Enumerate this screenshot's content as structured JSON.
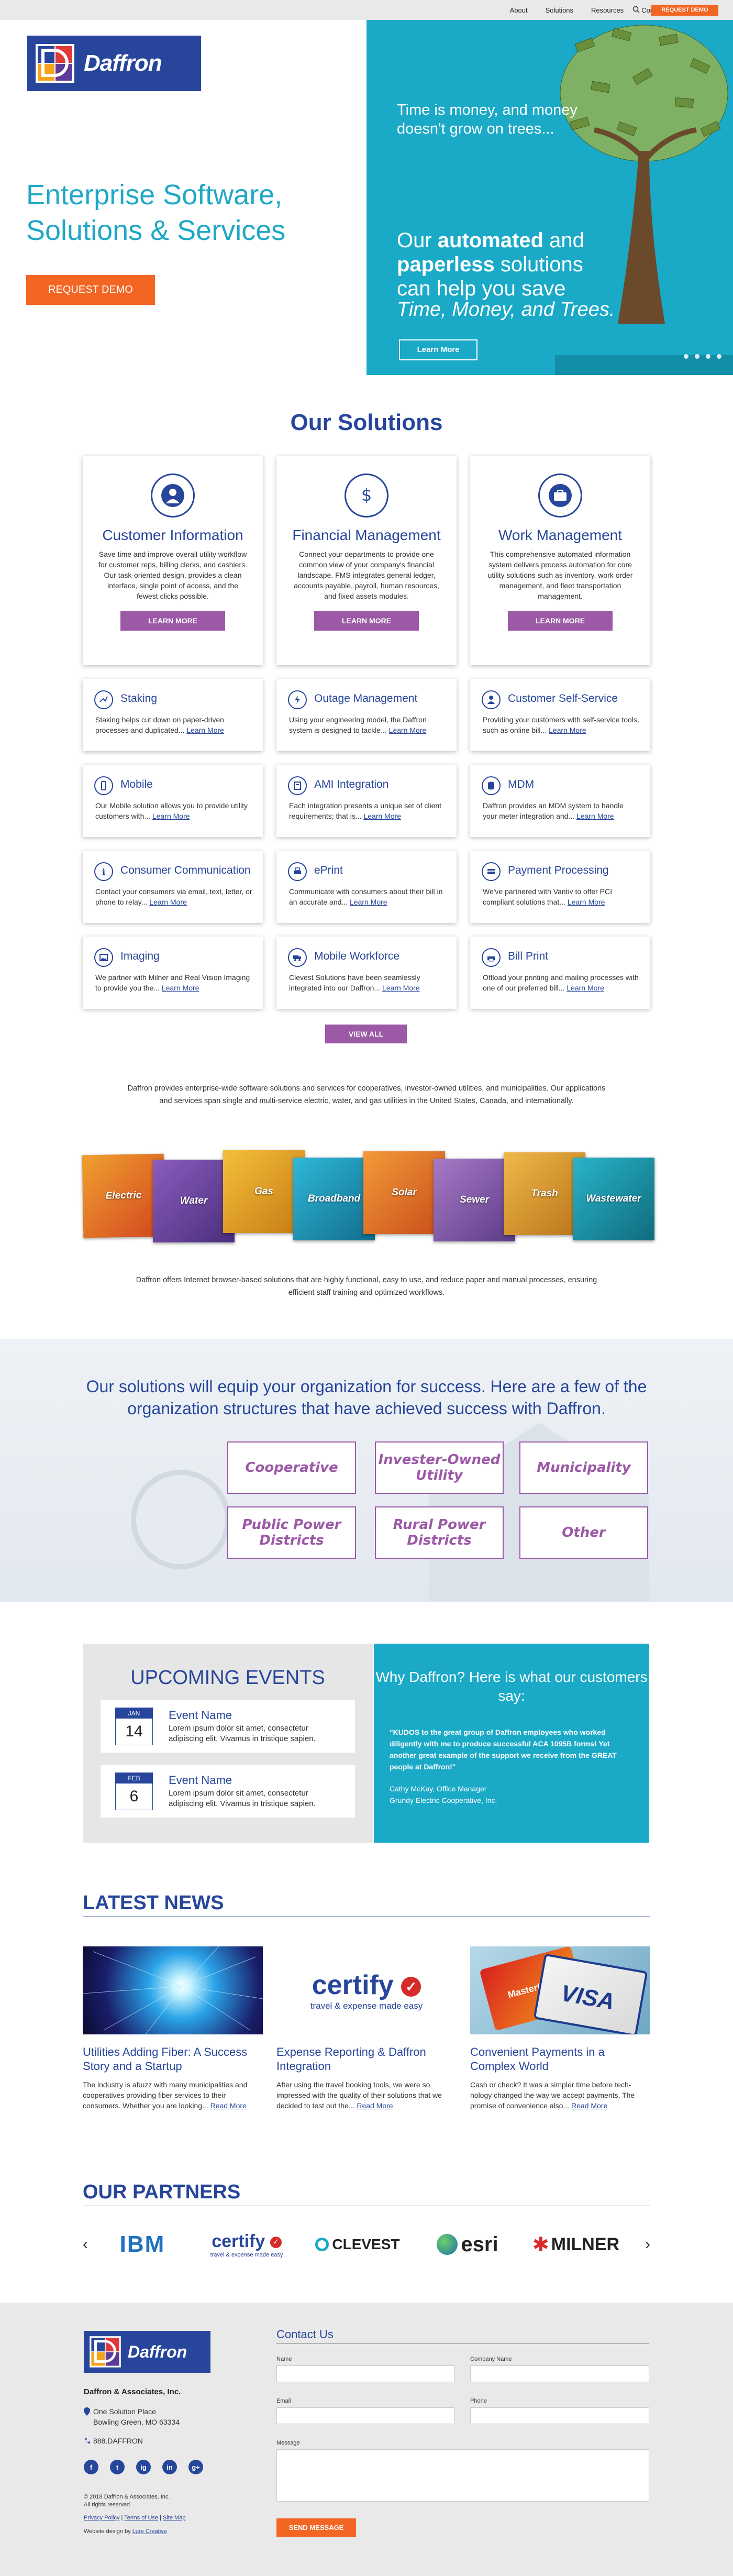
{
  "topnav": {
    "links": [
      "About",
      "Solutions",
      "Resources",
      "Contact"
    ],
    "demo": "REQUEST DEMO"
  },
  "hero": {
    "logo_text": "Daffron",
    "headline": "Enterprise Software, Solutions & Services",
    "cta": "REQUEST DEMO",
    "tagline1": "Time is money, and money doesn't grow on trees...",
    "tagline2_pre": "Our ",
    "tagline2_b1": "automated",
    "tagline2_mid": " and ",
    "tagline2_b2": "paperless",
    "tagline2_post": " solutions can help you save",
    "tagline3": "Time, Money, and Trees.",
    "more": "Learn More"
  },
  "solutions": {
    "title": "Our Solutions",
    "big": [
      {
        "title": "Customer Information",
        "icon": "user-icon",
        "text": "Save time and improve overall utility workflow for customer reps, billing clerks, and cashiers. Our task-oriented design, provides a clean interface, single point of access, and the fewest clicks possible.",
        "button": "LEARN MORE"
      },
      {
        "title": "Financial Management",
        "icon": "dollar-icon",
        "text": "Connect your departments to provide one common view of your company's financial landscape. FMS integrates general ledger, accounts payable, payroll, human resources, and fixed assets modules.",
        "button": "LEARN MORE"
      },
      {
        "title": "Work Management",
        "icon": "briefcase-icon",
        "text": "This comprehensive automated information system delivers process automation for core utility solutions such as inventory, work order management, and fleet transportation management.",
        "button": "LEARN MORE"
      }
    ],
    "small": [
      {
        "title": "Staking",
        "icon": "staking-icon",
        "text": "Staking helps cut down on paper-driven processes and duplicated...",
        "more": "Learn More"
      },
      {
        "title": "Outage Management",
        "icon": "lightning-icon",
        "text": "Using your engineering model, the Daffron system is designed to tackle...",
        "more": "Learn More"
      },
      {
        "title": "Customer Self-Service",
        "icon": "person-icon",
        "text": "Providing your customers with self-service tools, such as online bill...",
        "more": "Learn More"
      },
      {
        "title": "Mobile",
        "icon": "mobile-icon",
        "text": "Our Mobile solution allows you to provide utility customers with...",
        "more": "Learn More"
      },
      {
        "title": "AMI Integration",
        "icon": "meter-icon",
        "text": "Each integration presents a unique set of client requirements; that is...",
        "more": "Learn More"
      },
      {
        "title": "MDM",
        "icon": "database-icon",
        "text": "Daffron provides an MDM system to handle your meter integration and...",
        "more": "Learn More"
      },
      {
        "title": "Consumer Communication",
        "icon": "info-icon",
        "text": "Contact your consumers via email, text, letter, or phone to relay...",
        "more": "Learn More"
      },
      {
        "title": "ePrint",
        "icon": "print-icon",
        "text": "Communicate with consumers about their bill in an accurate and...",
        "more": "Learn More"
      },
      {
        "title": "Payment Processing",
        "icon": "payment-icon",
        "text": "We've partnered with Vantiv to offer PCI compliant solutions that...",
        "more": "Learn More"
      },
      {
        "title": "Imaging",
        "icon": "image-icon",
        "text": "We partner with Milner and Real Vision Imaging to provide you the...",
        "more": "Learn More"
      },
      {
        "title": "Mobile Workforce",
        "icon": "truck-icon",
        "text": "Clevest Solutions have been seamlessly integrated into our Daffron...",
        "more": "Learn More"
      },
      {
        "title": "Bill Print",
        "icon": "printer-icon",
        "text": "Offload your printing and mailing processes with one of our preferred bill...",
        "more": "Learn More"
      }
    ],
    "view_all": "VIEW ALL",
    "para1": "Daffron provides enterprise-wide software solutions and services for cooperatives, investor-owned utilities, and municipalities. Our applications and services span single and multi-service electric, water, and gas utilities in the United States, Canada, and internationally.",
    "para2": "Daffron offers Internet browser-based solutions that are highly functional, easy to use, and reduce paper and manual processes, ensuring efficient staff training and optimized workflows."
  },
  "industries": [
    "Electric",
    "Water",
    "Gas",
    "Broadband",
    "Solar",
    "Sewer",
    "Trash",
    "Wastewater"
  ],
  "orgs": {
    "title": "Our solutions will equip your organization for success. Here are a few of the organization structures that have achieved success with Daffron.",
    "items": [
      "Cooperative",
      "Invester-Owned Utility",
      "Municipality",
      "Public Power Districts",
      "Rural Power Districts",
      "Other"
    ]
  },
  "events": {
    "title": "UPCOMING EVENTS",
    "items": [
      {
        "month": "JAN",
        "day": "14",
        "title": "Event Name",
        "text": "Lorem ipsum dolor sit amet, consectetur adipiscing elit. Vivamus in tristique sapien."
      },
      {
        "month": "FEB",
        "day": "6",
        "title": "Event Name",
        "text": "Lorem ipsum dolor sit amet, consectetur adipiscing elit. Vivamus in tristique sapien."
      }
    ]
  },
  "quote": {
    "title": "Why Daffron? Here is what our customers say:",
    "text": "\"KUDOS to the great group of Daffron employees who worked diligently with me to produce successful ACA 1095B forms! Yet another great example of the support we receive from the GREAT people at Daffron!\"",
    "name": "Cathy McKay, Office Manager",
    "org": "Grundy Electric Cooperative, Inc."
  },
  "news": {
    "title": "LATEST NEWS",
    "items": [
      {
        "title": "Utilities Adding Fiber: A Success Story and a Startup",
        "text": "The industry is abuzz with many municipalities and cooperatives providing fiber services to their consumers. Whether you are looking...",
        "more": "Read More"
      },
      {
        "title": "Expense Reporting & Daffron Integration",
        "text": "After using the travel booking tools, we were so impressed with the quality of their solutions that we decided to test out the...",
        "more": "Read More"
      },
      {
        "title": "Convenient Payments in a Complex World",
        "text": "Cash or check? It was a simpler time before tech-nology changed the way we accept payments. The promise of convenience also...",
        "more": "Read More"
      }
    ],
    "certify_word": "certify",
    "certify_tag": "travel & expense made easy",
    "card_visa": "VISA",
    "card_mc": "MasterCard"
  },
  "partners": {
    "title": "OUR PARTNERS",
    "logos": [
      "IBM",
      "certify",
      "CLEVEST",
      "esri",
      "MILNER"
    ],
    "certify_tag": "travel & expense made easy"
  },
  "footer": {
    "logo_text": "Daffron",
    "company": "Daffron & Associates, Inc.",
    "addr1": "One Solution Place",
    "addr2": "Bowling Green, MO 63334",
    "phone": "888.DAFFRON",
    "social": [
      "f",
      "t",
      "ig",
      "in",
      "g+"
    ],
    "copyright1": "© 2018 Daffron & Associates, Inc.",
    "copyright2": "All rights reserved",
    "links": [
      "Privacy Policy",
      "Terms of Use",
      "Site Map"
    ],
    "design_pre": "Website design by ",
    "design_by": "Lure Creative",
    "contact_title": "Contact Us",
    "fields": {
      "name": "Name",
      "company": "Company Name",
      "email": "Email",
      "phone": "Phone",
      "message": "Message"
    },
    "send": "SEND MESSAGE"
  },
  "colors": {
    "brand_blue": "#27469b",
    "teal": "#1aa9c7",
    "orange": "#f26522",
    "purple": "#9b59a6"
  }
}
